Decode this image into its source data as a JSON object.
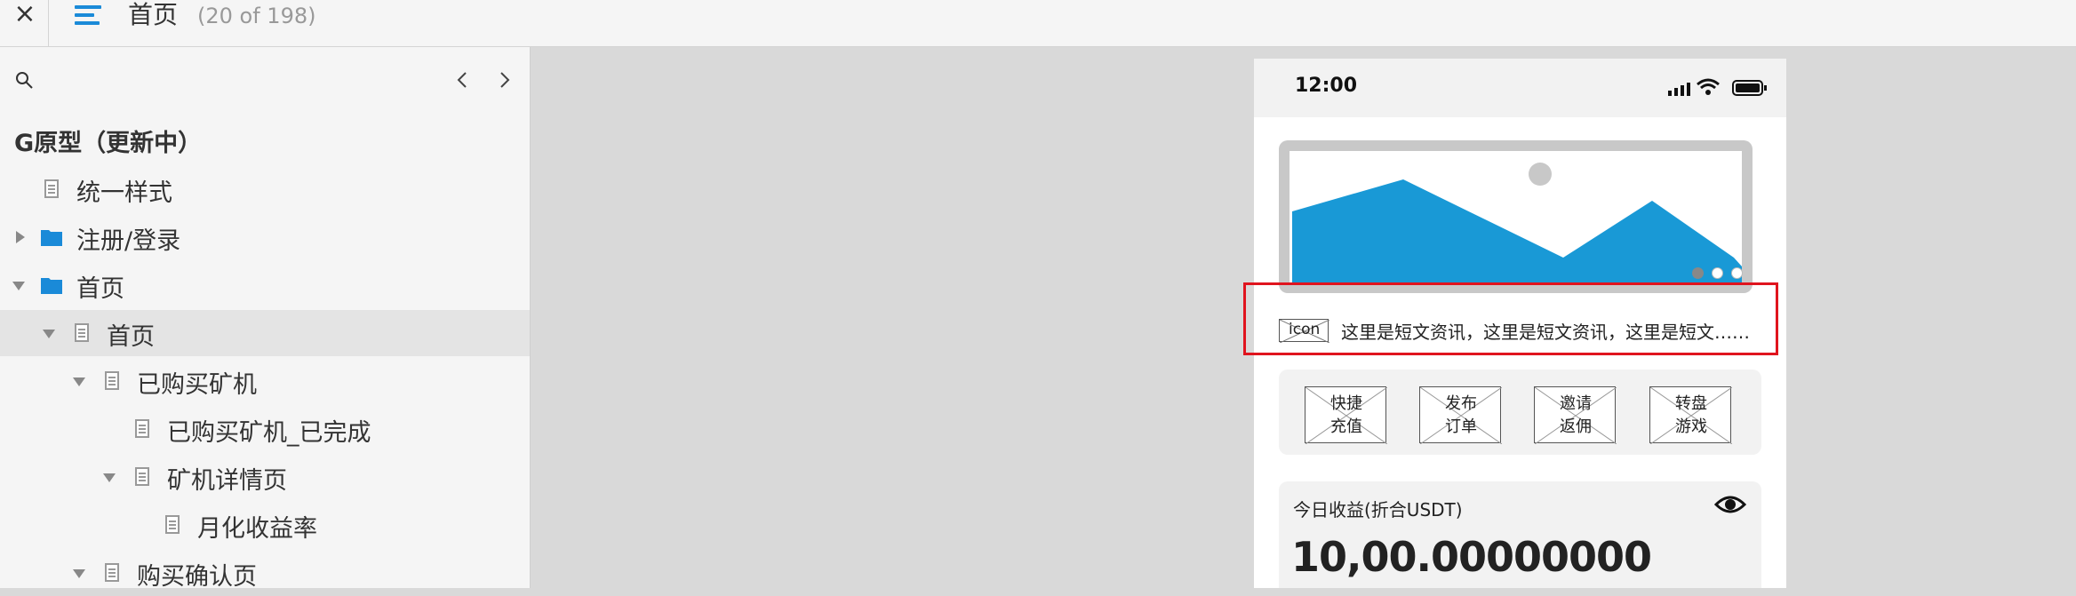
{
  "topbar": {
    "close_label": "×",
    "page_title": "首页",
    "page_count": "(20 of 198)"
  },
  "sidebar": {
    "project_title": "G原型（更新中）",
    "items": [
      {
        "label": "统一样式",
        "type": "page"
      },
      {
        "label": "注册/登录",
        "type": "folder",
        "expanded": false
      },
      {
        "label": "首页",
        "type": "folder",
        "expanded": true
      },
      {
        "label": "首页",
        "type": "page",
        "expanded": true,
        "selected": true
      },
      {
        "label": "已购买矿机",
        "type": "page",
        "expanded": true
      },
      {
        "label": "已购买矿机_已完成",
        "type": "page"
      },
      {
        "label": "矿机详情页",
        "type": "page",
        "expanded": true
      },
      {
        "label": "月化收益率",
        "type": "page"
      },
      {
        "label": "购买确认页",
        "type": "page",
        "expanded": true
      }
    ]
  },
  "phone": {
    "time": "12:00",
    "news_icon_label": "icon",
    "news_text": "这里是短文资讯，这里是短文资讯，这里是短文……",
    "quick_actions": [
      {
        "line1": "快捷",
        "line2": "充值"
      },
      {
        "line1": "发布",
        "line2": "订单"
      },
      {
        "line1": "邀请",
        "line2": "返佣"
      },
      {
        "line1": "转盘",
        "line2": "游戏"
      }
    ],
    "income_label": "今日收益(折合USDT)",
    "income_value": "10,00.00000000"
  },
  "colors": {
    "accent": "#1a8ad8",
    "banner_blue": "#1999d6",
    "highlight_red": "#e0141e"
  }
}
